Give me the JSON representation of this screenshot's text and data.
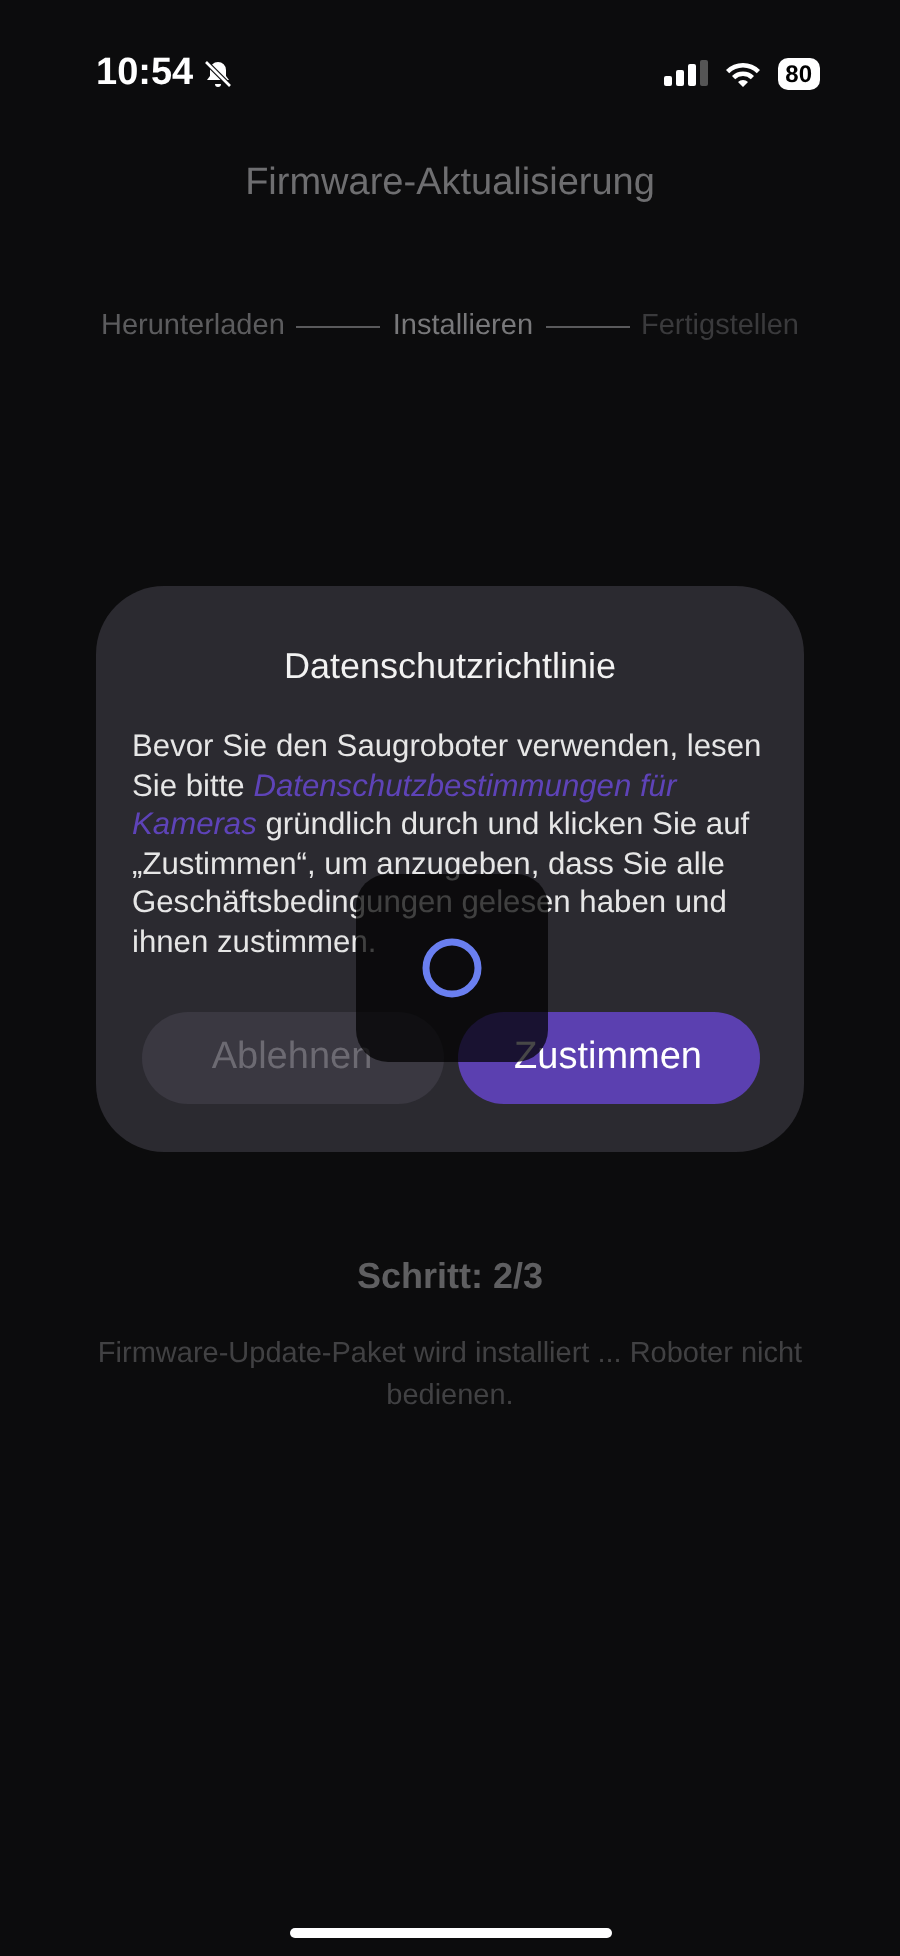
{
  "status_bar": {
    "time": "10:54",
    "battery": "80"
  },
  "title": "Firmware-Aktualisierung",
  "steps": [
    {
      "label": "Herunterladen",
      "completed": true,
      "selected": false
    },
    {
      "label": "Installieren",
      "completed": false,
      "selected": true
    },
    {
      "label": "Fertigstellen",
      "completed": false,
      "selected": false
    }
  ],
  "dialog": {
    "title": "Datenschutzrichtlinie",
    "body_before": "Bevor Sie den Saugroboter verwenden, lesen Sie bitte ",
    "link_lines": [
      "Datenschutzbestimmungen für",
      "Kameras"
    ],
    "body_after": " gründlich durch und klicken Sie auf „Zustimmen“, um anzugeben, dass Sie alle Geschäftsbedingungen gelesen haben und ihnen zustimmen.",
    "buttons": [
      {
        "label": "Ablehnen",
        "kind": "secondary"
      },
      {
        "label": "Zustimmen",
        "kind": "primary"
      }
    ],
    "loading": true
  },
  "progress": {
    "step": "Schritt: 2/3",
    "message": "Firmware-Update-Paket wird installiert ... Roboter nicht bedienen."
  }
}
